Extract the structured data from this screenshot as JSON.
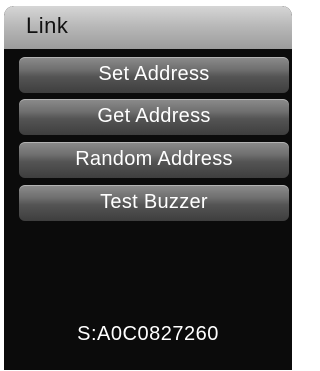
{
  "header": {
    "title": "Link"
  },
  "menu": {
    "items": [
      {
        "label": "Set Address"
      },
      {
        "label": "Get Address"
      },
      {
        "label": "Random Address"
      },
      {
        "label": "Test Buzzer"
      }
    ]
  },
  "footer": {
    "serial": "S:A0C0827260"
  },
  "colors": {
    "background": "#0b0b0b",
    "title_bar": "#b9b9b9",
    "button": "#5a5a5a",
    "text": "#ffffff"
  }
}
